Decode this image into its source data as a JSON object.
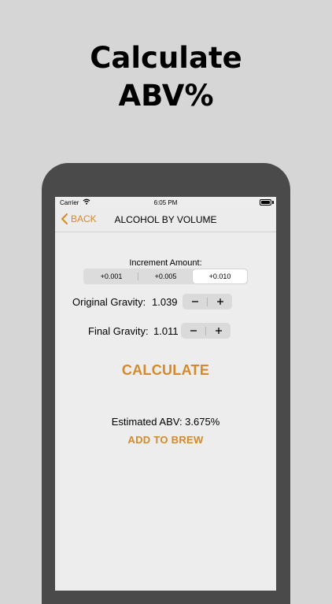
{
  "promo": {
    "headline_line1": "Calculate",
    "headline_line2": "ABV%"
  },
  "status_bar": {
    "carrier": "Carrier",
    "time": "6:05 PM"
  },
  "nav": {
    "back_label": "BACK",
    "title": "ALCOHOL BY VOLUME"
  },
  "increment": {
    "label": "Increment Amount:",
    "options": [
      "+0.001",
      "+0.005",
      "+0.010"
    ],
    "selected": "+0.010"
  },
  "original_gravity": {
    "label": "Original Gravity:",
    "value": "1.039"
  },
  "final_gravity": {
    "label": "Final Gravity:",
    "value": "1.011"
  },
  "calculate_label": "CALCULATE",
  "result": {
    "estimated_text": "Estimated ABV: 3.675%"
  },
  "add_to_brew_label": "ADD TO BREW",
  "colors": {
    "accent": "#d4892a",
    "background": "#d6d6d6",
    "device": "#4a4a4a",
    "screen": "#ededed"
  }
}
